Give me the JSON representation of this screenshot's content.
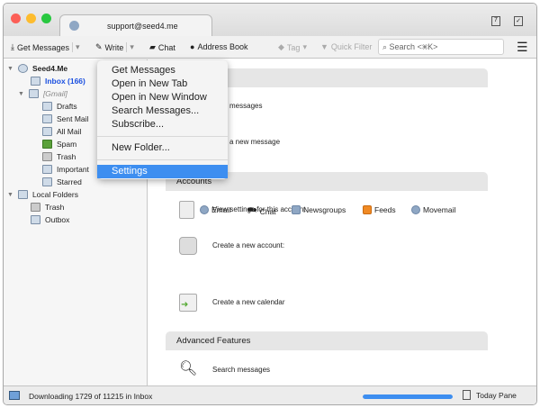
{
  "window": {
    "tab_title": "support@seed4.me"
  },
  "toolbar": {
    "get_messages": "Get Messages",
    "write": "Write",
    "chat": "Chat",
    "address_book": "Address Book",
    "tag": "Tag",
    "quick_filter": "Quick Filter",
    "search_placeholder": "Search <⌘K>"
  },
  "sidebar": {
    "account": "Seed4.Me",
    "inbox": "Inbox (166)",
    "gmail": "[Gmail]",
    "gmail_items": [
      "Drafts",
      "Sent Mail",
      "All Mail",
      "Spam",
      "Trash",
      "Important",
      "Starred"
    ],
    "local": "Local Folders",
    "local_items": [
      "Trash",
      "Outbox"
    ]
  },
  "context_menu": {
    "items": [
      "Get Messages",
      "Open in New Tab",
      "Open in New Window",
      "Search Messages...",
      "Subscribe..."
    ],
    "new_folder": "New Folder...",
    "settings": "Settings",
    "selected": "Settings"
  },
  "content": {
    "email_rows": [
      "messages",
      "a new message"
    ],
    "accounts_header": "Accounts",
    "view_settings": "View settings for this account",
    "create_account": "Create a new account:",
    "account_types": [
      "Email",
      "Chat",
      "Newsgroups",
      "Feeds",
      "Movemail"
    ],
    "create_calendar": "Create a new calendar",
    "advanced_header": "Advanced Features",
    "search_messages": "Search messages"
  },
  "status": {
    "text": "Downloading 1729 of 11215 in Inbox",
    "progress_fill": 1.0,
    "today_pane": "Today Pane"
  },
  "colors": {
    "accent": "#3d8ef0",
    "inbox_link": "#1a4fe0"
  }
}
